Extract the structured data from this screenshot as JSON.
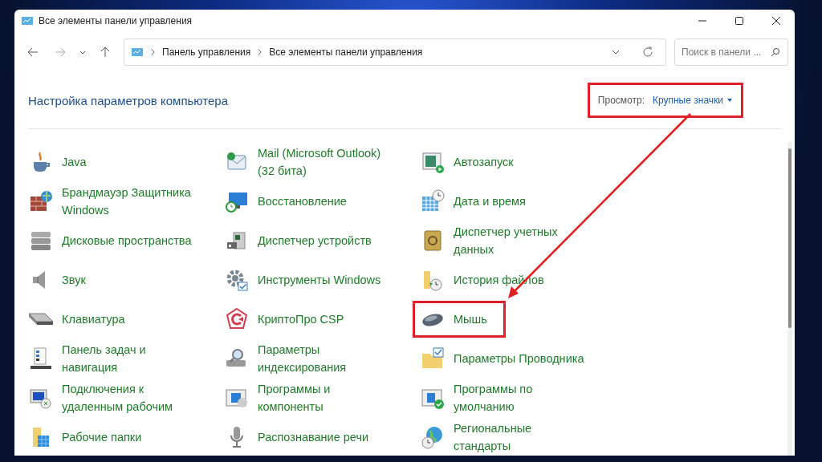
{
  "window": {
    "title": "Все элементы панели управления"
  },
  "address_bar": {
    "path": [
      "Панель управления",
      "Все элементы панели управления"
    ]
  },
  "search": {
    "placeholder": "Поиск в панели ..."
  },
  "heading": "Настройка параметров компьютера",
  "view": {
    "label": "Просмотр:",
    "value": "Крупные значки",
    "highlighted": true
  },
  "items": [
    {
      "label": "Java",
      "highlighted": false
    },
    {
      "label": "Mail (Microsoft Outlook) (32 бита)",
      "highlighted": false
    },
    {
      "label": "Автозапуск",
      "highlighted": false
    },
    {
      "label": "Брандмауэр Защитника Windows",
      "highlighted": false
    },
    {
      "label": "Восстановление",
      "highlighted": false
    },
    {
      "label": "Дата и время",
      "highlighted": false
    },
    {
      "label": "Дисковые пространства",
      "highlighted": false
    },
    {
      "label": "Диспетчер устройств",
      "highlighted": false
    },
    {
      "label": "Диспетчер учетных данных",
      "highlighted": false
    },
    {
      "label": "Звук",
      "highlighted": false
    },
    {
      "label": "Инструменты Windows",
      "highlighted": false
    },
    {
      "label": "История файлов",
      "highlighted": false
    },
    {
      "label": "Клавиатура",
      "highlighted": false
    },
    {
      "label": "КриптоПро CSP",
      "highlighted": false
    },
    {
      "label": "Мышь",
      "highlighted": true
    },
    {
      "label": "Панель задач и навигация",
      "highlighted": false
    },
    {
      "label": "Параметры индексирования",
      "highlighted": false
    },
    {
      "label": "Параметры Проводника",
      "highlighted": false
    },
    {
      "label": "Подключения к удаленным рабочим",
      "highlighted": false
    },
    {
      "label": "Программы и компоненты",
      "highlighted": false
    },
    {
      "label": "Программы по умолчанию",
      "highlighted": false
    },
    {
      "label": "Рабочие папки",
      "highlighted": false
    },
    {
      "label": "Распознавание речи",
      "highlighted": false
    },
    {
      "label": "Региональные стандарты",
      "highlighted": false
    }
  ]
}
